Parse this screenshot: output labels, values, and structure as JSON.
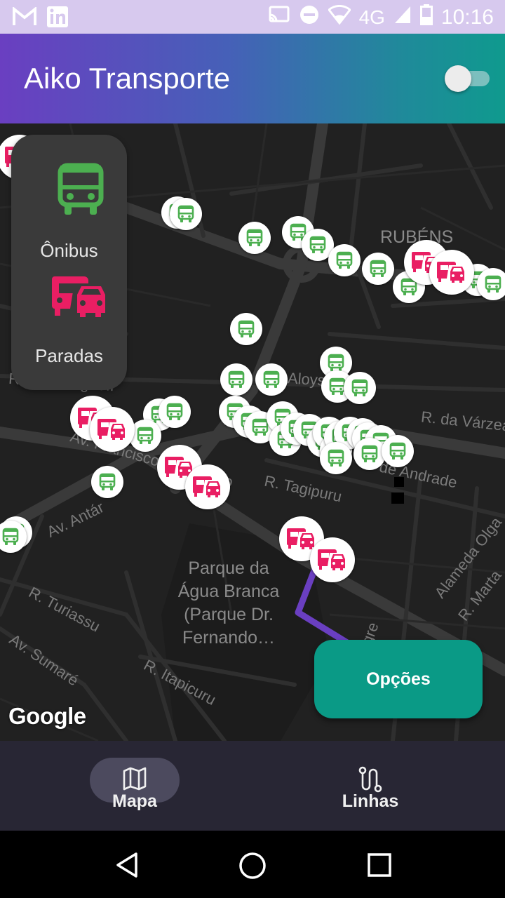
{
  "status_bar": {
    "time": "10:16",
    "network": "4G",
    "left_icons": [
      "gmail-icon",
      "linkedin-icon"
    ],
    "right_icons": [
      "cast-icon",
      "do-not-disturb-icon",
      "wifi-icon",
      "signal-icon",
      "battery-icon"
    ]
  },
  "app_bar": {
    "title": "Aiko Transporte",
    "toggle_state": "off"
  },
  "legend": {
    "bus_label": "Ônibus",
    "stop_label": "Paradas",
    "bus_color": "#4caf50",
    "stop_color": "#e91e63"
  },
  "map": {
    "district_label": "RUBÉNS",
    "park_label_lines": [
      "Parque da",
      "Água Branca",
      "(Parque Dr.",
      "Fernando…"
    ],
    "street_labels": {
      "borghoff": "R. C... Borghoff",
      "aloys": "Aloys",
      "varzea": "R. da Várzea",
      "francisco": "Av. Francisco Matarazzo",
      "tagipuru": "R. Tagipuru",
      "andrade": "de Andrade",
      "antartica": "Av. Antár",
      "olga": "Alameda Olga",
      "marta": "R. Marta",
      "turiassu": "R. Turiassu",
      "sumare": "Av. Sumaré",
      "itapicuru": "R. Itapicuru",
      "gre": "gre"
    },
    "attribution": "Google"
  },
  "options_button": {
    "label": "Opções"
  },
  "bottom_nav": {
    "items": [
      {
        "label": "Mapa",
        "icon": "map-icon",
        "selected": true
      },
      {
        "label": "Linhas",
        "icon": "route-icon",
        "selected": false
      }
    ]
  },
  "system_nav": [
    "back-icon",
    "home-icon",
    "recents-icon"
  ]
}
